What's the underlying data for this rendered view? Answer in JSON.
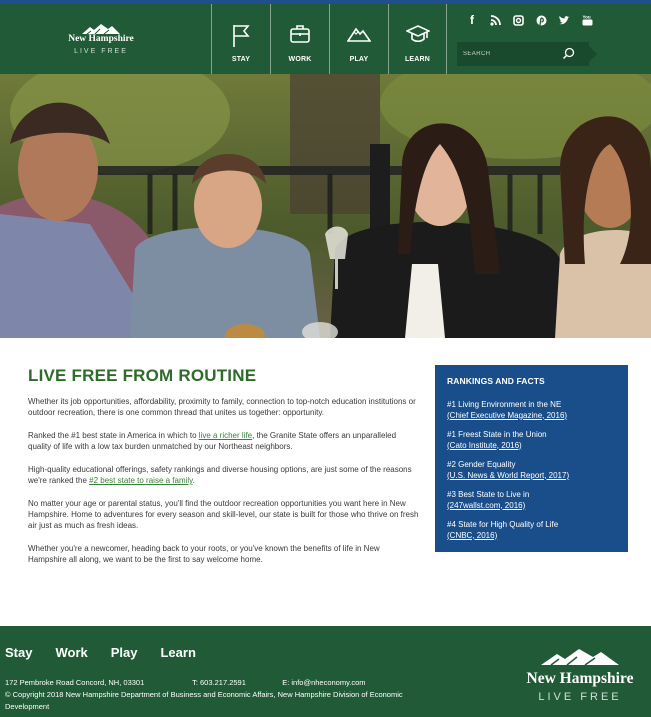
{
  "header": {
    "logo": {
      "name": "New Hampshire",
      "tagline": "LIVE FREE"
    },
    "nav": [
      {
        "label": "STAY",
        "icon": "flag-icon"
      },
      {
        "label": "WORK",
        "icon": "briefcase-icon"
      },
      {
        "label": "PLAY",
        "icon": "mountain-icon"
      },
      {
        "label": "LEARN",
        "icon": "graduation-cap-icon"
      }
    ],
    "social": [
      {
        "icon": "facebook-icon",
        "glyph": "f"
      },
      {
        "icon": "rss-icon",
        "glyph": ""
      },
      {
        "icon": "instagram-icon",
        "glyph": ""
      },
      {
        "icon": "pinterest-icon",
        "glyph": ""
      },
      {
        "icon": "twitter-icon",
        "glyph": ""
      },
      {
        "icon": "youtube-icon",
        "glyph": ""
      }
    ],
    "search": {
      "placeholder": "SEARCH"
    }
  },
  "main": {
    "heading": "LIVE FREE FROM ROUTINE",
    "p1": "Whether its job opportunities, affordability, proximity to family, connection to top-notch education institutions or outdoor recreation, there is one common thread that unites us together: opportunity.",
    "p2": {
      "before": "Ranked the #1 best state in America in which to ",
      "link": "live a richer life",
      "after": ", the Granite State offers an unparalleled quality of life with a low tax burden unmatched by our Northeast neighbors."
    },
    "p3": {
      "before": "High-quality educational offerings, safety rankings and diverse housing options, are just some of the reasons we're ranked the ",
      "link": "#2 best state to raise a family",
      "after": "."
    },
    "p4": "No matter your age or parental status, you'll find the outdoor recreation opportunities you want here in New Hampshire. Home to adventures for every season and skill-level, our state is built for those who thrive on fresh air just as much as fresh ideas.",
    "p5": "Whether you're a newcomer, heading back to your roots, or you've known the benefits of life in New Hampshire all along, we want to be the first to say welcome home."
  },
  "rankings": {
    "title": "RANKINGS AND FACTS",
    "items": [
      {
        "rank": "#1 Living Environment in the NE",
        "source": "(Chief Executive Magazine, 2016)"
      },
      {
        "rank": "#1 Freest State in the Union",
        "source": "(Cato Institute, 2016)"
      },
      {
        "rank": "#2 Gender Equality",
        "source": "(U.S. News & World Report, 2017)"
      },
      {
        "rank": "#3 Best State to Live in",
        "source": "(247wallst.com, 2016)"
      },
      {
        "rank": "#4 State for High Quality of Life",
        "source": "(CNBC, 2016)"
      }
    ]
  },
  "footer": {
    "nav": [
      "Stay",
      "Work",
      "Play",
      "Learn"
    ],
    "address": "172 Pembroke Road Concord, NH, 03301",
    "phone": "T: 603.217.2591",
    "email": "E: info@nheconomy.com",
    "copyright": "© Copyright 2018 New Hampshire Department of Business and Economic Affairs, New Hampshire Division of Economic Development",
    "logo": {
      "name": "New Hampshire",
      "tagline": "LIVE FREE"
    }
  },
  "colors": {
    "header_green": "#215a36",
    "heading_green": "#2e6b28",
    "facts_blue": "#1a4e8a"
  }
}
